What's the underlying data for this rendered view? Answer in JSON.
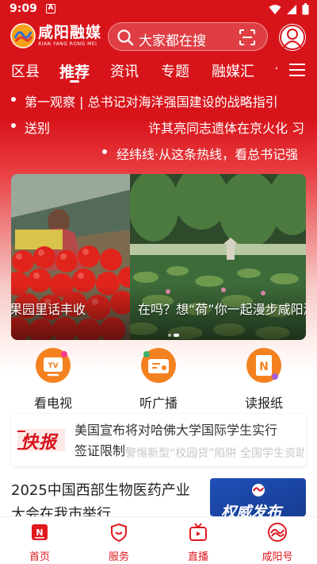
{
  "status_bar": {
    "time": "9:09",
    "notification_badge": "A"
  },
  "header": {
    "logo_title": "咸阳融媒",
    "logo_subtitle": "XIAN YANG RONG MEI",
    "search_placeholder": "大家都在搜"
  },
  "tabs": [
    {
      "label": "区县",
      "active": false
    },
    {
      "label": "推荐",
      "active": true
    },
    {
      "label": "资讯",
      "active": false
    },
    {
      "label": "专题",
      "active": false
    },
    {
      "label": "融媒汇",
      "active": false
    },
    {
      "label": "·",
      "active": false
    }
  ],
  "tickers": [
    {
      "text": "第一观察 | 总书记对海洋强国建设的战略指引"
    },
    {
      "left_text": "送别",
      "text": "许其亮同志遗体在京火化 习"
    },
    {
      "text": "经纬线·从这条热线，看总书记强"
    }
  ],
  "carousel": {
    "slides": [
      {
        "caption": "果园里话丰收"
      },
      {
        "caption": "在吗？想“荷”你一起漫步咸阳湖"
      }
    ],
    "dot_count": 2,
    "active_dot": 2
  },
  "quick_links": [
    {
      "label": "看电视",
      "icon": "tv-icon"
    },
    {
      "label": "听广播",
      "icon": "radio-icon"
    },
    {
      "label": "读报纸",
      "icon": "newspaper-icon"
    }
  ],
  "flash_news": {
    "badge": "快报",
    "line1": "美国宣布将对哈佛大学国际学生实行",
    "line2": "签证限制",
    "line2_overlap": "警惕新型“校园贷”陷阱 全国学生资助"
  },
  "article": {
    "title": "2025中国西部生物医药产业大会在我市举行",
    "thumb_text": "权威发布"
  },
  "bottom_nav": [
    {
      "label": "首页",
      "icon": "home-icon"
    },
    {
      "label": "服务",
      "icon": "service-icon"
    },
    {
      "label": "直播",
      "icon": "live-icon"
    },
    {
      "label": "咸阳号",
      "icon": "xianyang-account-icon"
    }
  ],
  "colors": {
    "brand_red": "#d8141b",
    "nav_red": "#e0191f",
    "icon_orange": "#f4811f"
  }
}
